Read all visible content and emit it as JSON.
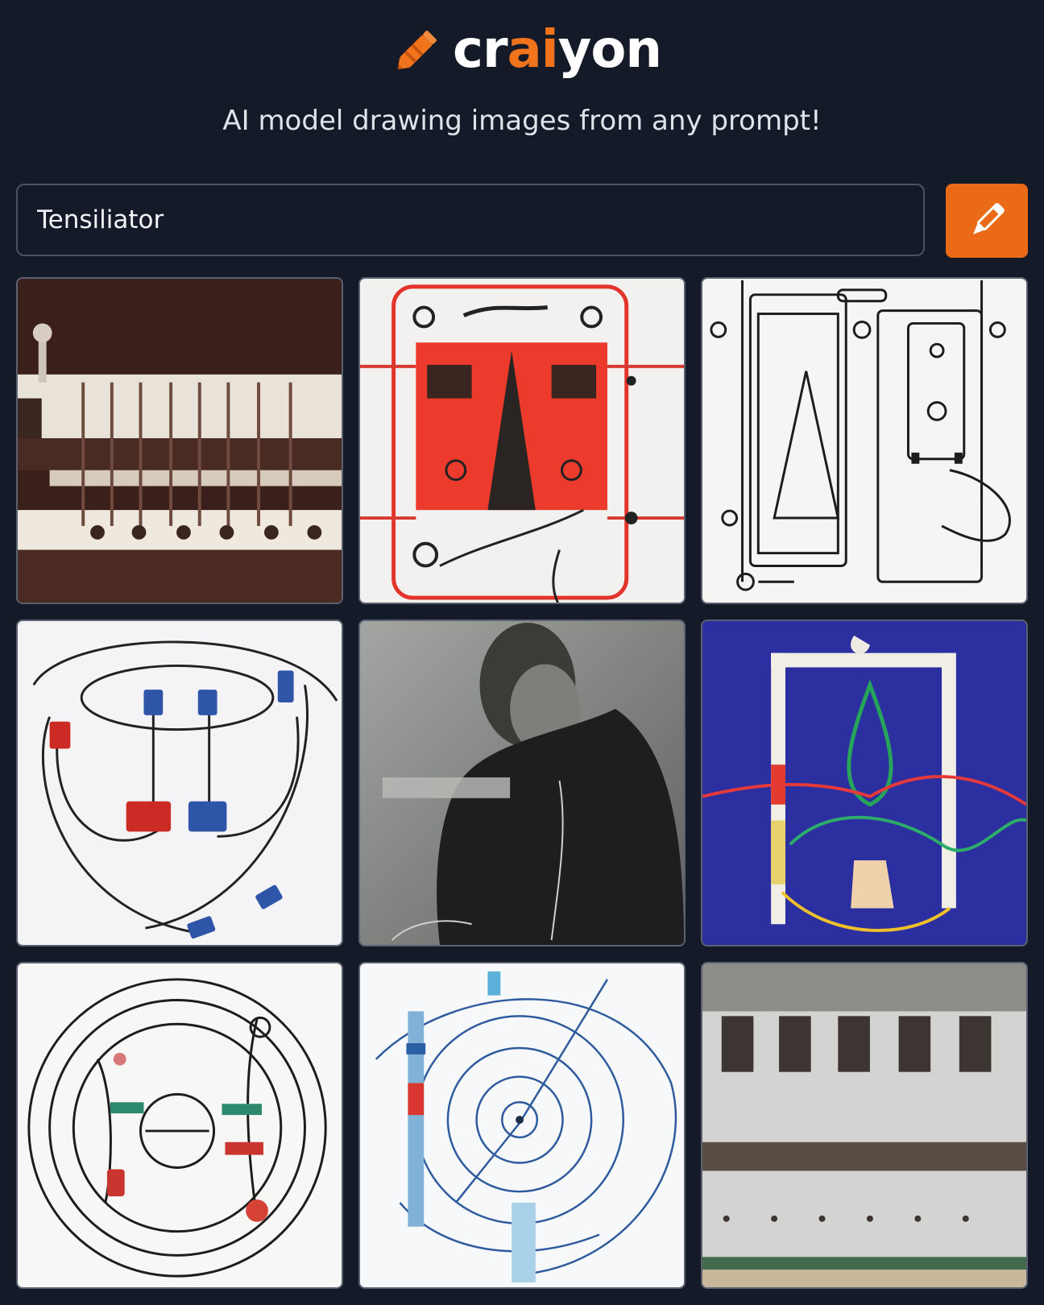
{
  "brand": {
    "logo_prefix": "cr",
    "logo_accent": "ai",
    "logo_suffix": "yon",
    "logo_icon": "crayon-icon",
    "accent_color": "#f1731c"
  },
  "tagline": "AI model drawing images from any prompt!",
  "prompt": {
    "value": "Tensiliator",
    "placeholder": "Tensiliator"
  },
  "draw_button": {
    "icon": "pencil-icon",
    "color": "#eb6a17"
  },
  "results": [
    {
      "id": "result-image-1",
      "description_icon": "image"
    },
    {
      "id": "result-image-2",
      "description_icon": "image"
    },
    {
      "id": "result-image-3",
      "description_icon": "image"
    },
    {
      "id": "result-image-4",
      "description_icon": "image"
    },
    {
      "id": "result-image-5",
      "description_icon": "image"
    },
    {
      "id": "result-image-6",
      "description_icon": "image"
    },
    {
      "id": "result-image-7",
      "description_icon": "image"
    },
    {
      "id": "result-image-8",
      "description_icon": "image"
    },
    {
      "id": "result-image-9",
      "description_icon": "image"
    }
  ]
}
